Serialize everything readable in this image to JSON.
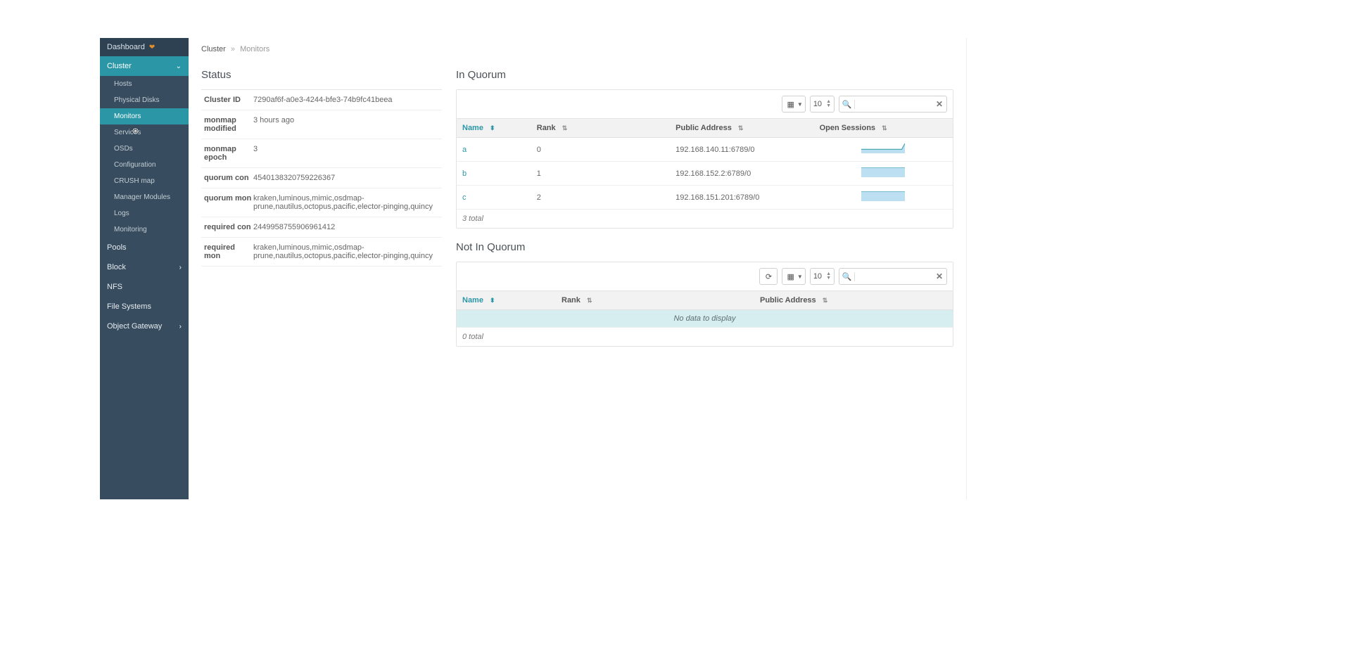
{
  "brand": {
    "title": "Dashboard"
  },
  "sidebar": {
    "cluster_label": "Cluster",
    "cluster_items": [
      {
        "label": "Hosts"
      },
      {
        "label": "Physical Disks"
      },
      {
        "label": "Monitors"
      },
      {
        "label": "Services"
      },
      {
        "label": "OSDs"
      },
      {
        "label": "Configuration"
      },
      {
        "label": "CRUSH map"
      },
      {
        "label": "Manager Modules"
      },
      {
        "label": "Logs"
      },
      {
        "label": "Monitoring"
      }
    ],
    "items_after": [
      {
        "label": "Pools"
      },
      {
        "label": "Block",
        "expandable": true
      },
      {
        "label": "NFS"
      },
      {
        "label": "File Systems"
      },
      {
        "label": "Object Gateway",
        "expandable": true
      }
    ]
  },
  "breadcrumb": {
    "root": "Cluster",
    "current": "Monitors"
  },
  "status": {
    "title": "Status",
    "rows": [
      {
        "k": "Cluster ID",
        "v": "7290af6f-a0e3-4244-bfe3-74b9fc41beea"
      },
      {
        "k": "monmap modified",
        "v": "3 hours ago"
      },
      {
        "k": "monmap epoch",
        "v": "3"
      },
      {
        "k": "quorum con",
        "v": "4540138320759226367"
      },
      {
        "k": "quorum mon",
        "v": "kraken,luminous,mimic,osdmap-prune,nautilus,octopus,pacific,elector-pinging,quincy"
      },
      {
        "k": "required con",
        "v": "2449958755906961412"
      },
      {
        "k": "required mon",
        "v": "kraken,luminous,mimic,osdmap-prune,nautilus,octopus,pacific,elector-pinging,quincy"
      }
    ]
  },
  "in_quorum": {
    "title": "In Quorum",
    "page_size": "10",
    "columns": [
      {
        "label": "Name",
        "sorted": "asc"
      },
      {
        "label": "Rank"
      },
      {
        "label": "Public Address"
      },
      {
        "label": "Open Sessions"
      }
    ],
    "rows": [
      {
        "name": "a",
        "rank": "0",
        "addr": "192.168.140.11:6789/0",
        "spark": [
          5,
          5,
          5,
          5,
          5,
          5,
          5,
          5,
          5,
          5,
          5,
          5,
          5,
          5,
          12
        ]
      },
      {
        "name": "b",
        "rank": "1",
        "addr": "192.168.152.2:6789/0",
        "spark": [
          5,
          5,
          5,
          5,
          5,
          5,
          5,
          5,
          5,
          5,
          5,
          5,
          5,
          5,
          5
        ]
      },
      {
        "name": "c",
        "rank": "2",
        "addr": "192.168.151.201:6789/0",
        "spark": [
          5,
          5,
          5,
          5,
          5,
          5,
          5,
          5,
          5,
          5,
          5,
          5,
          5,
          5,
          5
        ]
      }
    ],
    "footer": "3 total"
  },
  "not_in_quorum": {
    "title": "Not In Quorum",
    "page_size": "10",
    "columns": [
      {
        "label": "Name",
        "sorted": "asc"
      },
      {
        "label": "Rank"
      },
      {
        "label": "Public Address"
      }
    ],
    "empty_text": "No data to display",
    "footer": "0 total"
  },
  "colors": {
    "accent": "#2b97a6",
    "sidebar_bg": "#374d5f"
  }
}
